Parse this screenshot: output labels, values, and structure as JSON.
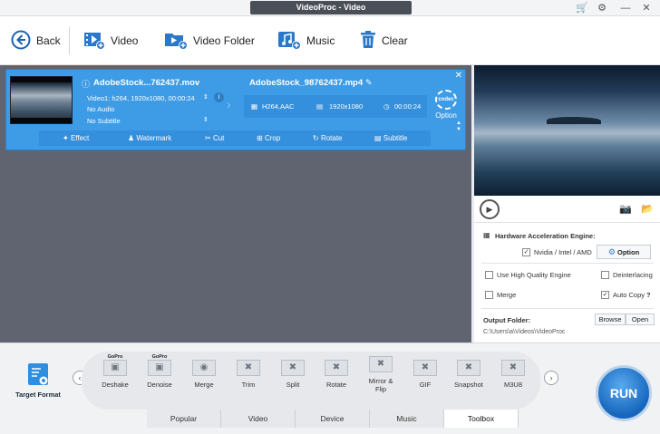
{
  "window": {
    "title": "VideoProc - Video"
  },
  "toolbar": {
    "back": "Back",
    "video": "Video",
    "video_folder": "Video Folder",
    "music": "Music",
    "clear": "Clear"
  },
  "item": {
    "source_name": "AdobeStock...762437.mov",
    "video_info": "Video1: h264, 1920x1080, 00:00:24",
    "audio": "No Audio",
    "subtitle": "No Subtitle",
    "output_name": "AdobeStock_98762437.mp4",
    "output_codec": "H264,AAC",
    "output_resolution": "1920x1080",
    "output_duration": "00:00:24",
    "codec_badge": "codec",
    "option_label": "Option"
  },
  "edit_tools": [
    "Effect",
    "Watermark",
    "Cut",
    "Crop",
    "Rotate",
    "Subtitle"
  ],
  "settings": {
    "hw_title": "Hardware Acceleration Engine:",
    "hw_vendor": "Nvidia / Intel / AMD",
    "hw_vendor_checked": true,
    "option_button": "Option",
    "high_quality": "Use High Quality Engine",
    "high_quality_checked": false,
    "deinterlacing": "Deinterlacing",
    "deinterlacing_checked": false,
    "merge": "Merge",
    "merge_checked": false,
    "auto_copy": "Auto Copy",
    "auto_copy_checked": true,
    "help": "?",
    "output_folder_label": "Output Folder:",
    "browse": "Browse",
    "open": "Open",
    "output_path": "C:\\Users\\a\\Videos\\VideoProc"
  },
  "bottom": {
    "target_format": "Target Format",
    "gopro": "GoPro",
    "tools": [
      "Deshake",
      "Denoise",
      "Merge",
      "Trim",
      "Split",
      "Rotate",
      "Mirror & Flip",
      "GIF",
      "Snapshot",
      "M3U8"
    ],
    "tabs": [
      "Popular",
      "Video",
      "Device",
      "Music",
      "Toolbox"
    ],
    "active_tab": "Toolbox",
    "run": "RUN"
  },
  "colors": {
    "accent": "#3e9be6",
    "run": "#1565bd",
    "workarea": "#5f6470"
  }
}
